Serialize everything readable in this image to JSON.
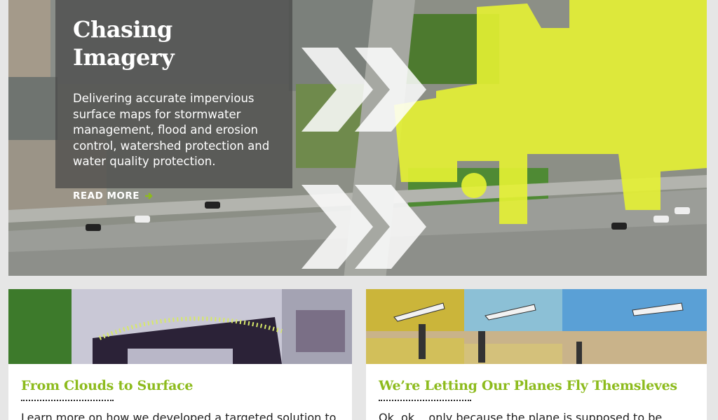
{
  "hero": {
    "title": "Chasing Imagery",
    "description": "Delivering accurate impervious surface maps for stormwater management, flood and erosion control, watershed protection and water quality protection.",
    "read_more": "READ MORE",
    "accent_color": "#8dbb1d",
    "highlight_color": "#e6f233"
  },
  "cards": [
    {
      "title": "From Clouds to Surface",
      "text": "Learn more on how we developed a targeted solution to"
    },
    {
      "title": "We’re Letting Our Planes Fly Themsleves",
      "text": "Ok, ok... only because the plane is supposed to be"
    }
  ]
}
